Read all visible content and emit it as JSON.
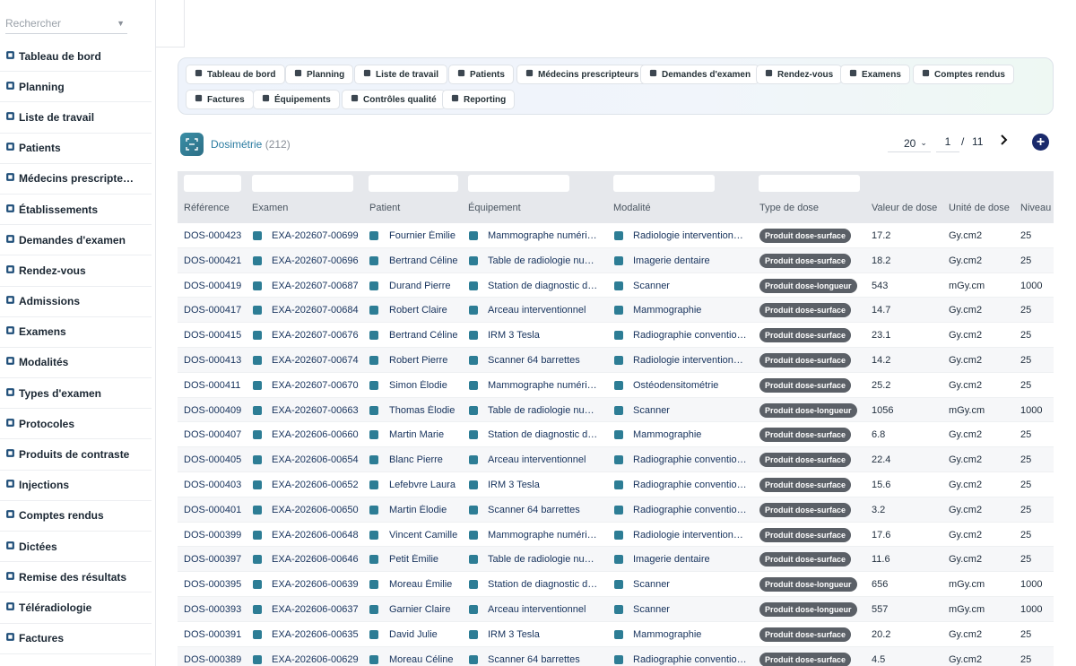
{
  "search": {
    "placeholder": "Rechercher"
  },
  "sidebar": {
    "items": [
      {
        "label": "Tableau de bord",
        "icon": "gauge-icon"
      },
      {
        "label": "Planning",
        "icon": "calendar-icon"
      },
      {
        "label": "Liste de travail",
        "icon": "worklist-icon"
      },
      {
        "label": "Patients",
        "icon": "users-icon"
      },
      {
        "label": "Médecins prescripte…",
        "icon": "doctor-icon"
      },
      {
        "label": "Établissements",
        "icon": "building-icon"
      },
      {
        "label": "Demandes d'examen",
        "icon": "file-plus-icon"
      },
      {
        "label": "Rendez-vous",
        "icon": "calendar-check-icon"
      },
      {
        "label": "Admissions",
        "icon": "id-card-icon"
      },
      {
        "label": "Examens",
        "icon": "exam-icon"
      },
      {
        "label": "Modalités",
        "icon": "modality-icon"
      },
      {
        "label": "Types d'examen",
        "icon": "clipboard-icon"
      },
      {
        "label": "Protocoles",
        "icon": "clipboard-list-icon"
      },
      {
        "label": "Produits de contraste",
        "icon": "dropper-icon"
      },
      {
        "label": "Injections",
        "icon": "syringe-icon"
      },
      {
        "label": "Comptes rendus",
        "icon": "report-icon"
      },
      {
        "label": "Dictées",
        "icon": "microphone-icon"
      },
      {
        "label": "Remise des résultats",
        "icon": "printer-icon"
      },
      {
        "label": "Téléradiologie",
        "icon": "broadcast-icon"
      },
      {
        "label": "Factures",
        "icon": "invoice-icon"
      }
    ]
  },
  "quick_links": [
    {
      "label": "Tableau de bord",
      "icon": "gauge-icon"
    },
    {
      "label": "Planning",
      "icon": "calendar-icon"
    },
    {
      "label": "Liste de travail",
      "icon": "worklist-icon"
    },
    {
      "label": "Patients",
      "icon": "users-icon"
    },
    {
      "label": "Médecins prescripteurs",
      "icon": "doctor-icon"
    },
    {
      "label": "Demandes d'examen",
      "icon": "file-plus-icon"
    },
    {
      "label": "Rendez-vous",
      "icon": "calendar-check-icon"
    },
    {
      "label": "Examens",
      "icon": "exam-icon"
    },
    {
      "label": "Comptes rendus",
      "icon": "report-icon"
    },
    {
      "label": "Factures",
      "icon": "invoice-icon"
    },
    {
      "label": "Équipements",
      "icon": "gears-icon"
    },
    {
      "label": "Contrôles qualité",
      "icon": "clipboard-check-icon"
    },
    {
      "label": "Reporting",
      "icon": "pie-chart-icon"
    }
  ],
  "page": {
    "title": "Dosimétrie",
    "count": "(212)"
  },
  "pager": {
    "page_size": "20",
    "current_page": "1",
    "separator": "/",
    "total_pages": "11"
  },
  "colors": {
    "accent": "#2b7ca1",
    "add_button": "#1a2a6c",
    "badge": "#5b6067",
    "row_icon": "#2d7d95"
  },
  "table": {
    "columns": [
      "Référence",
      "Examen",
      "Patient",
      "Équipement",
      "Modalité",
      "Type de dose",
      "Valeur de dose",
      "Unité de dose",
      "Niveau"
    ],
    "rows": [
      [
        "DOS-000423",
        "EXA-202607-00699",
        "Fournier Émilie",
        "Mammographe numéri…",
        "Radiologie intervention…",
        "Produit dose-surface",
        "17.2",
        "Gy.cm2",
        "25"
      ],
      [
        "DOS-000421",
        "EXA-202607-00696",
        "Bertrand Céline",
        "Table de radiologie num…",
        "Imagerie dentaire",
        "Produit dose-surface",
        "18.2",
        "Gy.cm2",
        "25"
      ],
      [
        "DOS-000419",
        "EXA-202607-00687",
        "Durand Pierre",
        "Station de diagnostic d…",
        "Scanner",
        "Produit dose-longueur",
        "543",
        "mGy.cm",
        "1000"
      ],
      [
        "DOS-000417",
        "EXA-202607-00684",
        "Robert Claire",
        "Arceau interventionnel",
        "Mammographie",
        "Produit dose-surface",
        "14.7",
        "Gy.cm2",
        "25"
      ],
      [
        "DOS-000415",
        "EXA-202607-00676",
        "Bertrand Céline",
        "IRM 3 Tesla",
        "Radiographie conventio…",
        "Produit dose-surface",
        "23.1",
        "Gy.cm2",
        "25"
      ],
      [
        "DOS-000413",
        "EXA-202607-00674",
        "Robert Pierre",
        "Scanner 64 barrettes",
        "Radiologie intervention…",
        "Produit dose-surface",
        "14.2",
        "Gy.cm2",
        "25"
      ],
      [
        "DOS-000411",
        "EXA-202607-00670",
        "Simon Élodie",
        "Mammographe numéri…",
        "Ostéodensitométrie",
        "Produit dose-surface",
        "25.2",
        "Gy.cm2",
        "25"
      ],
      [
        "DOS-000409",
        "EXA-202607-00663",
        "Thomas Élodie",
        "Table de radiologie num…",
        "Scanner",
        "Produit dose-longueur",
        "1056",
        "mGy.cm",
        "1000"
      ],
      [
        "DOS-000407",
        "EXA-202606-00660",
        "Martin Marie",
        "Station de diagnostic d…",
        "Mammographie",
        "Produit dose-surface",
        "6.8",
        "Gy.cm2",
        "25"
      ],
      [
        "DOS-000405",
        "EXA-202606-00654",
        "Blanc Pierre",
        "Arceau interventionnel",
        "Radiographie conventio…",
        "Produit dose-surface",
        "22.4",
        "Gy.cm2",
        "25"
      ],
      [
        "DOS-000403",
        "EXA-202606-00652",
        "Lefebvre Laura",
        "IRM 3 Tesla",
        "Radiographie conventio…",
        "Produit dose-surface",
        "15.6",
        "Gy.cm2",
        "25"
      ],
      [
        "DOS-000401",
        "EXA-202606-00650",
        "Martin Élodie",
        "Scanner 64 barrettes",
        "Radiographie conventio…",
        "Produit dose-surface",
        "3.2",
        "Gy.cm2",
        "25"
      ],
      [
        "DOS-000399",
        "EXA-202606-00648",
        "Vincent Camille",
        "Mammographe numéri…",
        "Radiologie intervention…",
        "Produit dose-surface",
        "17.6",
        "Gy.cm2",
        "25"
      ],
      [
        "DOS-000397",
        "EXA-202606-00646",
        "Petit Émilie",
        "Table de radiologie num…",
        "Imagerie dentaire",
        "Produit dose-surface",
        "11.6",
        "Gy.cm2",
        "25"
      ],
      [
        "DOS-000395",
        "EXA-202606-00639",
        "Moreau Émilie",
        "Station de diagnostic d…",
        "Scanner",
        "Produit dose-longueur",
        "656",
        "mGy.cm",
        "1000"
      ],
      [
        "DOS-000393",
        "EXA-202606-00637",
        "Garnier Claire",
        "Arceau interventionnel",
        "Scanner",
        "Produit dose-longueur",
        "557",
        "mGy.cm",
        "1000"
      ],
      [
        "DOS-000391",
        "EXA-202606-00635",
        "David Julie",
        "IRM 3 Tesla",
        "Mammographie",
        "Produit dose-surface",
        "20.2",
        "Gy.cm2",
        "25"
      ],
      [
        "DOS-000389",
        "EXA-202606-00629",
        "Moreau Céline",
        "Scanner 64 barrettes",
        "Radiographie conventio…",
        "Produit dose-surface",
        "4.5",
        "Gy.cm2",
        "25"
      ]
    ]
  }
}
